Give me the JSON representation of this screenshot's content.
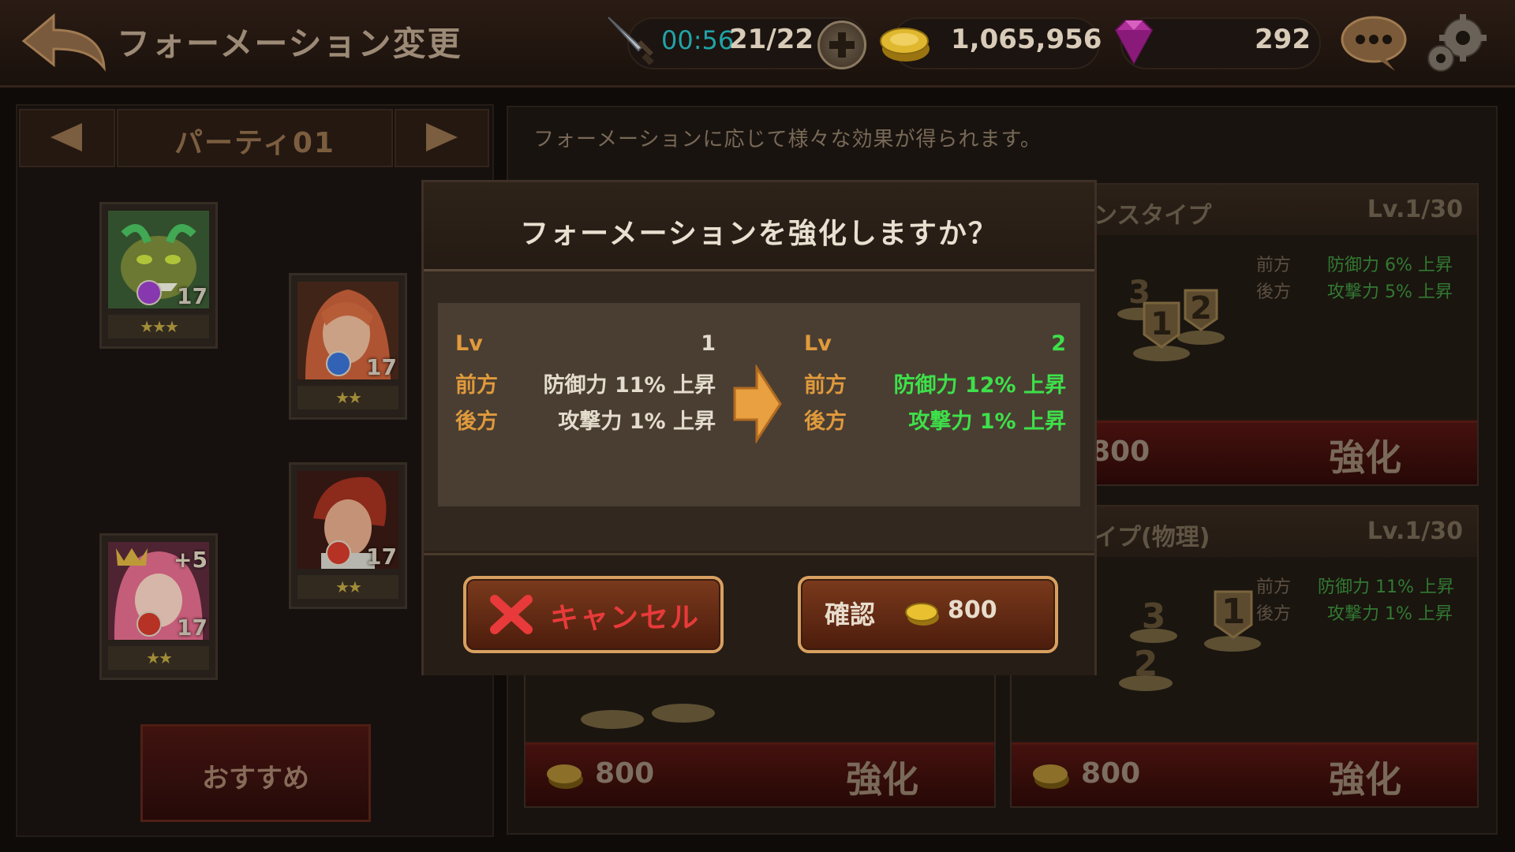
{
  "header": {
    "title": "フォーメーション変更",
    "stamina_timer": "00:56",
    "stamina_count": "21/22",
    "coins": "1,065,956",
    "gems": "292"
  },
  "party": {
    "name": "パーティ01",
    "units": [
      {
        "level": "17",
        "plus": "",
        "stars": "★★★",
        "stars_count": 3
      },
      {
        "level": "17",
        "plus": "",
        "stars": "★★",
        "stars_count": 2
      },
      {
        "level": "17",
        "plus": "",
        "stars": "★★",
        "stars_count": 2
      },
      {
        "level": "17",
        "plus": "+5",
        "stars": "★★",
        "stars_count": 2
      }
    ],
    "recommend_label": "おすすめ"
  },
  "info_text": "フォーメーションに応じて様々な効果が得られます。",
  "formation_cards": [
    {
      "name": "ンスタイプ",
      "level": "Lv.1/30",
      "front_label": "前方",
      "front_val": "防御力 6% 上昇",
      "back_label": "後方",
      "back_val": "攻撃力 5% 上昇",
      "cost": "800",
      "enhance_label": "強化"
    },
    {
      "name": "イプ(物理)",
      "level": "Lv.1/30",
      "front_label": "前方",
      "front_val": "防御力 11% 上昇",
      "back_label": "後方",
      "back_val": "攻撃力 1% 上昇",
      "cost": "800",
      "enhance_label": "強化"
    },
    {
      "name": "",
      "level": "",
      "cost": "800",
      "enhance_label": "強化"
    }
  ],
  "modal": {
    "title": "フォーメーションを強化しますか？",
    "labels": {
      "lv": "Lv",
      "front": "前方",
      "back": "後方"
    },
    "current": {
      "lv": "1",
      "front": "防御力 11% 上昇",
      "back": "攻撃力 1% 上昇"
    },
    "next": {
      "lv": "2",
      "front": "防御力 12% 上昇",
      "back": "攻撃力 1% 上昇"
    },
    "cancel_label": "キャンセル",
    "confirm_label": "確認",
    "confirm_cost": "800"
  },
  "colors": {
    "accent_orange": "#e09a3c",
    "upgrade_green": "#3ee04a",
    "cancel_red": "#e83a3a"
  }
}
